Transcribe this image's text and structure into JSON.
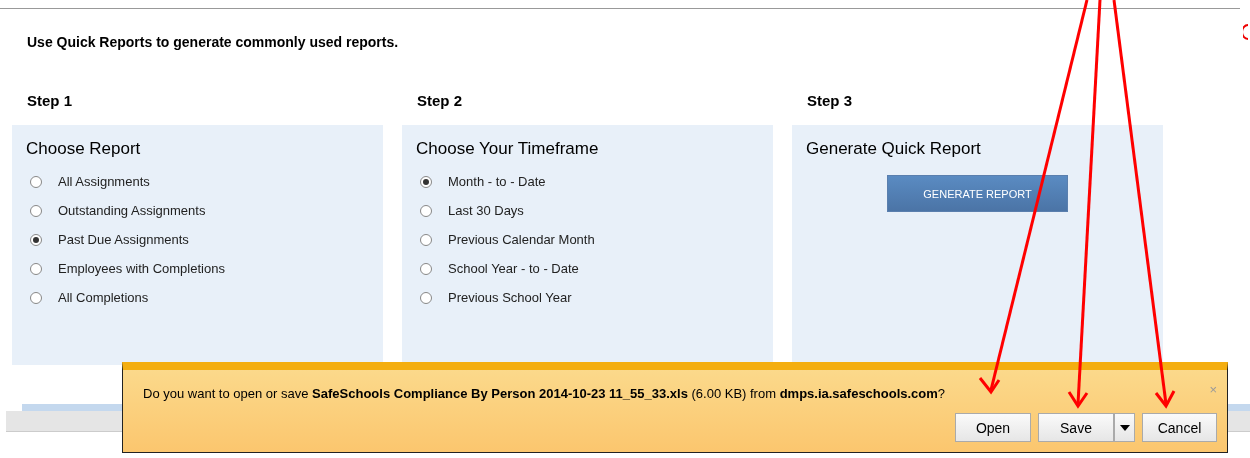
{
  "intro": "Use Quick Reports to generate commonly used reports.",
  "steps": [
    {
      "step": "Step 1",
      "title": "Choose Report",
      "kind": "radios",
      "options": [
        {
          "label": "All Assignments",
          "selected": false
        },
        {
          "label": "Outstanding Assignments",
          "selected": false
        },
        {
          "label": "Past Due Assignments",
          "selected": true
        },
        {
          "label": "Employees with Completions",
          "selected": false
        },
        {
          "label": "All Completions",
          "selected": false
        }
      ]
    },
    {
      "step": "Step 2",
      "title": "Choose Your Timeframe",
      "kind": "radios",
      "options": [
        {
          "label": "Month - to - Date",
          "selected": true
        },
        {
          "label": "Last 30 Days",
          "selected": false
        },
        {
          "label": "Previous Calendar Month",
          "selected": false
        },
        {
          "label": "School Year - to - Date",
          "selected": false
        },
        {
          "label": "Previous School Year",
          "selected": false
        }
      ]
    },
    {
      "step": "Step 3",
      "title": "Generate Quick Report",
      "kind": "button",
      "button": "GENERATE REPORT"
    }
  ],
  "download_bar": {
    "message": "Do you want to open or save **SafeSchools Compliance By Person 2014-10-23 11_55_33.xls** (6.00 KB) from **dmps.ia.safeschools.com**?",
    "close": "×",
    "buttons": [
      "Open",
      "Save",
      "Cancel"
    ]
  }
}
